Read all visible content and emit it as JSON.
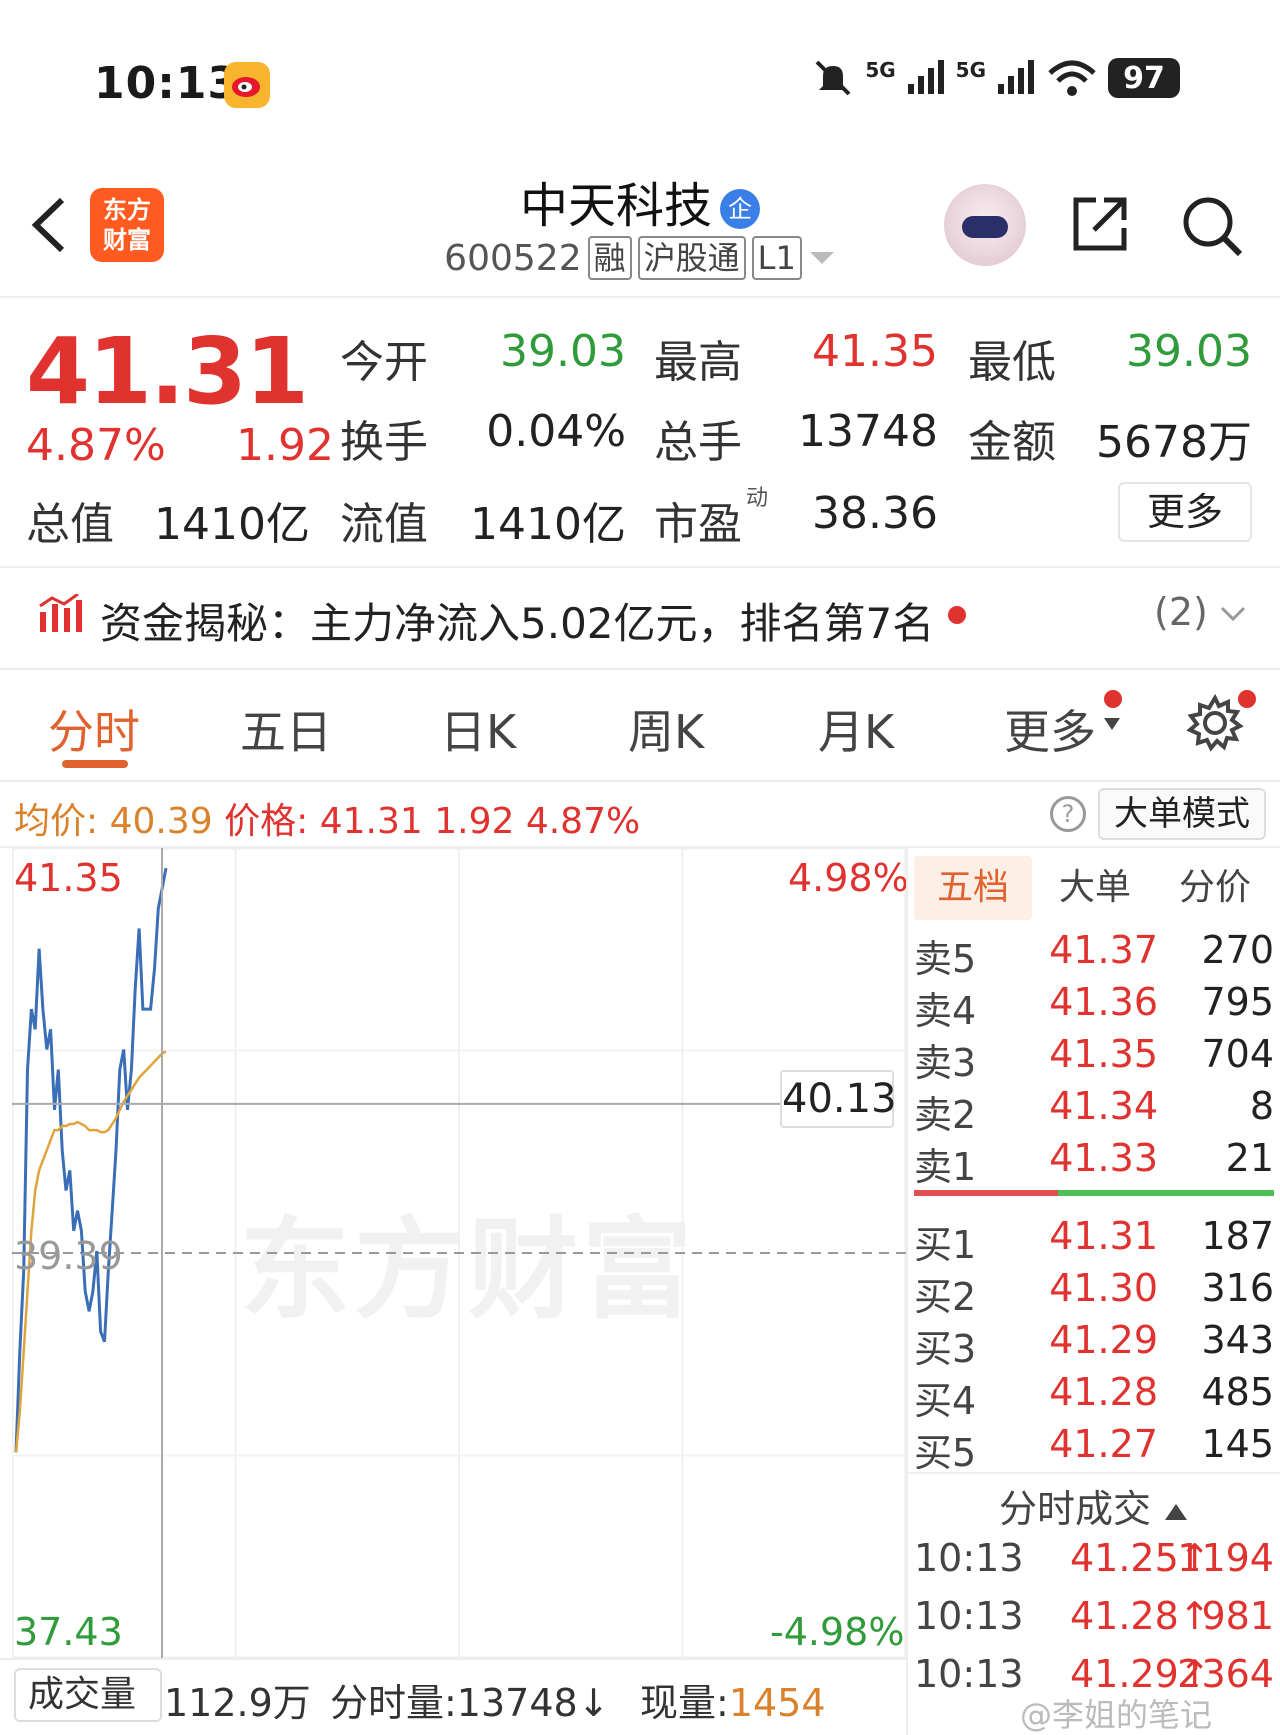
{
  "status_bar": {
    "time": "10:13",
    "signal_1": "5G",
    "signal_2": "5G",
    "battery": "97",
    "icons": [
      "weibo-icon",
      "mute-icon",
      "signal-icon",
      "wifi-icon",
      "battery-icon"
    ]
  },
  "nav": {
    "app_logo_line1": "东方",
    "app_logo_line2": "财富",
    "stock_name": "中天科技",
    "verified_badge": "企",
    "stock_code": "600522",
    "tags": [
      "融",
      "沪股通",
      "L1"
    ]
  },
  "quote": {
    "last_price": "41.31",
    "pct_change": "4.87%",
    "abs_change": "1.92",
    "fields": [
      {
        "label": "今开",
        "value": "39.03",
        "color": "green"
      },
      {
        "label": "最高",
        "value": "41.35",
        "color": "red"
      },
      {
        "label": "最低",
        "value": "39.03",
        "color": "green"
      },
      {
        "label": "换手",
        "value": "0.04%",
        "color": "default"
      },
      {
        "label": "总手",
        "value": "13748",
        "color": "default"
      },
      {
        "label": "金额",
        "value": "5678万",
        "color": "default"
      },
      {
        "label": "总值",
        "value": "1410亿",
        "color": "default"
      },
      {
        "label": "流值",
        "value": "1410亿",
        "color": "default"
      },
      {
        "label": "市盈",
        "value": "38.36",
        "color": "default"
      }
    ],
    "pe_superscript": "动",
    "more_button": "更多"
  },
  "capital_flow": {
    "text": "资金揭秘：主力净流入5.02亿元，排名第7名",
    "count": "(2)"
  },
  "tabs": [
    "分时",
    "五日",
    "日K",
    "周K",
    "月K",
    "更多"
  ],
  "summary": {
    "avg_label": "均价:",
    "avg_value": "40.39",
    "price_label": "价格:",
    "price_value": "41.31",
    "change": "1.92",
    "pct": "4.87%",
    "mode_button": "大单模式",
    "help": "?"
  },
  "chart_data": {
    "type": "line",
    "y_top": "41.35",
    "y_mid": "39.39",
    "y_bottom": "37.43",
    "pct_top": "4.98%",
    "pct_bottom": "-4.98%",
    "crosshair_price": "40.13",
    "ylim": [
      37.43,
      41.35
    ],
    "prev_close": 39.39,
    "watermark": "东方财富",
    "series": [
      {
        "values": [
          38.4,
          38.9,
          39.3,
          40.3,
          40.6,
          40.5,
          40.9,
          40.6,
          40.4,
          40.5,
          40.1,
          40.3,
          39.9,
          39.7,
          39.8,
          39.5,
          39.6,
          39.5,
          39.2,
          39.1,
          39.2,
          39.4,
          39.0,
          38.95,
          39.3,
          39.6,
          39.9,
          40.3,
          40.4,
          40.1,
          40.3,
          40.7,
          41.0,
          40.6,
          40.6,
          40.6,
          40.8,
          41.1,
          41.2,
          41.3
        ]
      },
      {
        "values": [
          38.4,
          38.6,
          38.9,
          39.2,
          39.5,
          39.7,
          39.8,
          39.85,
          39.9,
          39.95,
          40.0,
          40.0,
          40.02,
          40.02,
          40.03,
          40.03,
          40.04,
          40.03,
          40.02,
          40.0,
          40.0,
          40.0,
          39.99,
          39.99,
          40.0,
          40.03,
          40.06,
          40.1,
          40.14,
          40.17,
          40.2,
          40.23,
          40.26,
          40.28,
          40.3,
          40.32,
          40.34,
          40.36,
          40.38,
          40.39
        ]
      }
    ],
    "colors": {
      "price_line": "#3a6fb8",
      "avg_line": "#e0a43c"
    }
  },
  "order_book": {
    "tabs": [
      "五档",
      "大单",
      "分价"
    ],
    "asks": [
      {
        "label": "卖5",
        "price": "41.37",
        "volume": "270"
      },
      {
        "label": "卖4",
        "price": "41.36",
        "volume": "795"
      },
      {
        "label": "卖3",
        "price": "41.35",
        "volume": "704"
      },
      {
        "label": "卖2",
        "price": "41.34",
        "volume": "8"
      },
      {
        "label": "卖1",
        "price": "41.33",
        "volume": "21"
      }
    ],
    "bids": [
      {
        "label": "买1",
        "price": "41.31",
        "volume": "187"
      },
      {
        "label": "买2",
        "price": "41.30",
        "volume": "316"
      },
      {
        "label": "买3",
        "price": "41.29",
        "volume": "343"
      },
      {
        "label": "买4",
        "price": "41.28",
        "volume": "485"
      },
      {
        "label": "买5",
        "price": "41.27",
        "volume": "145"
      }
    ],
    "ticks_header": "分时成交",
    "ticks": [
      {
        "time": "10:13",
        "price": "41.25",
        "volume": "1194"
      },
      {
        "time": "10:13",
        "price": "41.28",
        "volume": "981"
      },
      {
        "time": "10:13",
        "price": "41.29",
        "volume": "2364"
      }
    ]
  },
  "volume_bar": {
    "selector": "成交量",
    "total": "112.9万",
    "minute_label": "分时量:13748↓",
    "current_label": "现量:",
    "current_value": "1454"
  },
  "watermark_corner": "@李姐的笔记"
}
